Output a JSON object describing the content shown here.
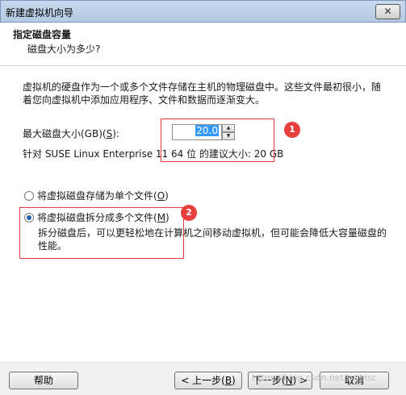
{
  "window": {
    "title": "新建虚拟机向导",
    "close_glyph": "✕"
  },
  "header": {
    "title": "指定磁盘容量",
    "subtitle": "磁盘大小为多少?"
  },
  "description": "虚拟机的硬盘作为一个或多个文件存储在主机的物理磁盘中。这些文件最初很小，随着您向虚拟机中添加应用程序、文件和数据而逐渐变大。",
  "disk_size": {
    "label_prefix": "最大磁盘大小(GB)(",
    "label_key": "S",
    "label_suffix": "):",
    "value": "20.0",
    "recommended": "针对 SUSE Linux Enterprise 11 64 位 的建议大小: 20 GB"
  },
  "options": [
    {
      "prefix": "将虚拟磁盘存储为单个文件(",
      "key": "O",
      "suffix": ")",
      "selected": false
    },
    {
      "prefix": "将虚拟磁盘拆分成多个文件(",
      "key": "M",
      "suffix": ")",
      "selected": true
    }
  ],
  "split_description": "拆分磁盘后，可以更轻松地在计算机之间移动虚拟机，但可能会降低大容量磁盘的性能。",
  "annotations": {
    "badge1": "1",
    "badge2": "2",
    "color": "#e8413d"
  },
  "footer": {
    "help": "帮助",
    "back_prefix": "< 上一步(",
    "back_key": "B",
    "back_suffix": ")",
    "next_prefix": "下一步(",
    "next_key": "N",
    "next_suffix": ") >",
    "cancel": "取消"
  },
  "watermark": "https://blog.csdn.net/mrpisc"
}
